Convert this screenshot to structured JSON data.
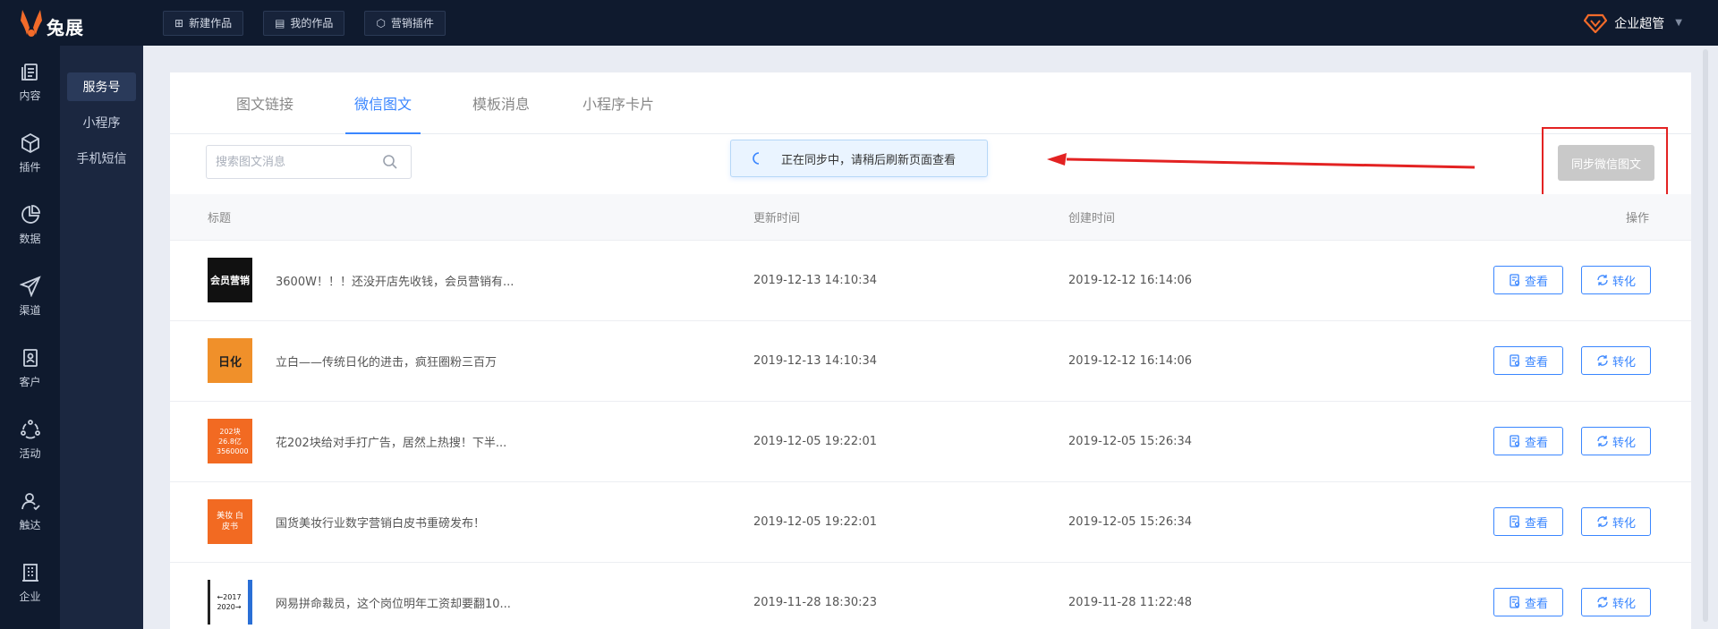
{
  "brand": {
    "name": "兔展",
    "accent": "#f26b2a"
  },
  "topbar": {
    "buttons": [
      {
        "label": "新建作品",
        "icon": "plus-square-icon"
      },
      {
        "label": "我的作品",
        "icon": "list-icon"
      },
      {
        "label": "营销插件",
        "icon": "cube-icon"
      }
    ],
    "user": {
      "label": "企业超管",
      "icon": "diamond-badge-icon"
    }
  },
  "rail": [
    {
      "label": "内容",
      "icon": "document-icon"
    },
    {
      "label": "插件",
      "icon": "cube-icon"
    },
    {
      "label": "数据",
      "icon": "pie-chart-icon"
    },
    {
      "label": "渠道",
      "icon": "paper-plane-icon"
    },
    {
      "label": "客户",
      "icon": "contact-card-icon"
    },
    {
      "label": "活动",
      "icon": "activity-icon"
    },
    {
      "label": "触达",
      "icon": "user-reach-icon"
    },
    {
      "label": "企业",
      "icon": "building-icon"
    }
  ],
  "subnav": [
    {
      "label": "服务号",
      "active": true
    },
    {
      "label": "小程序",
      "active": false
    },
    {
      "label": "手机短信",
      "active": false
    }
  ],
  "tabs": [
    {
      "label": "图文链接",
      "active": false
    },
    {
      "label": "微信图文",
      "active": true
    },
    {
      "label": "模板消息",
      "active": false
    },
    {
      "label": "小程序卡片",
      "active": false
    }
  ],
  "search": {
    "placeholder": "搜索图文消息",
    "value": ""
  },
  "toast": {
    "text": "正在同步中，请稍后刷新页面查看"
  },
  "sync_button": {
    "label": "同步微信图文"
  },
  "table": {
    "headers": {
      "title": "标题",
      "updated": "更新时间",
      "created": "创建时间",
      "actions": "操作"
    },
    "view_label": "查看",
    "convert_label": "转化",
    "rows": [
      {
        "title": "3600W！！！还没开店先收钱，会员营销有...",
        "updated": "2019-12-13 14:10:34",
        "created": "2019-12-12 16:14:06",
        "thumb_text": "会员营销"
      },
      {
        "title": "立白——传统日化的进击，疯狂圈粉三百万",
        "updated": "2019-12-13 14:10:34",
        "created": "2019-12-12 16:14:06",
        "thumb_text": "日化"
      },
      {
        "title": "花202块给对手打广告，居然上热搜！下半...",
        "updated": "2019-12-05 19:22:01",
        "created": "2019-12-05 15:26:34",
        "thumb_text": "202块 26.8亿 3560000"
      },
      {
        "title": "国货美妆行业数字营销白皮书重磅发布！",
        "updated": "2019-12-05 19:22:01",
        "created": "2019-12-05 15:26:34",
        "thumb_text": "美妆 白皮书"
      },
      {
        "title": "网易拼命裁员，这个岗位明年工资却要翻10...",
        "updated": "2019-11-28 18:30:23",
        "created": "2019-11-28 11:22:48",
        "thumb_text": "←2017 2020→"
      }
    ]
  },
  "colors": {
    "primary": "#3a86ff",
    "highlight_red": "#e32222",
    "dark_nav": "#0f1a2e"
  }
}
